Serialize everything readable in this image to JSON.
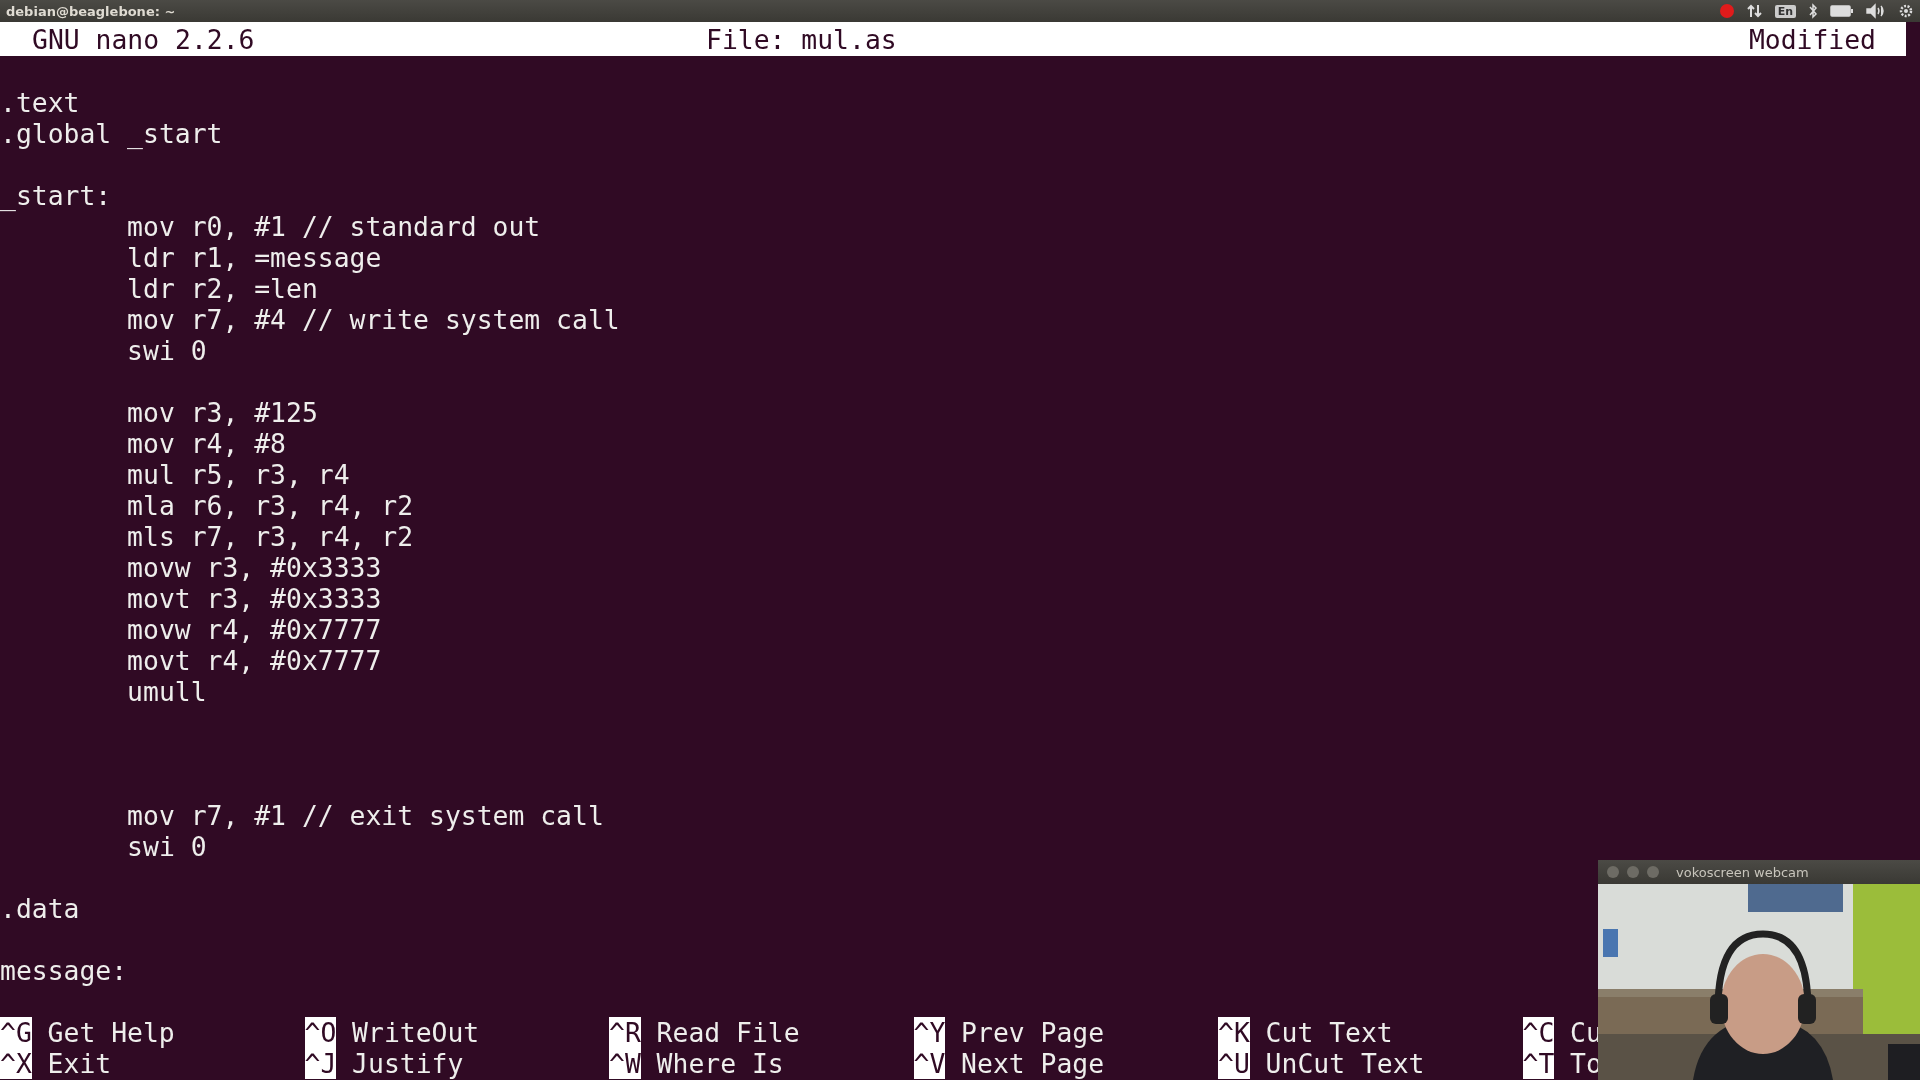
{
  "top_panel": {
    "title": "debian@beaglebone: ~",
    "keyboard_layout": "En"
  },
  "nano": {
    "header": {
      "version": "GNU nano 2.2.6",
      "file": "File: mul.as",
      "status": "Modified"
    },
    "lines": [
      {
        "kind": "blank"
      },
      {
        "kind": "code",
        "text": ".text"
      },
      {
        "kind": "code",
        "text": ".global _start"
      },
      {
        "kind": "blank"
      },
      {
        "kind": "code",
        "text": "_start:"
      },
      {
        "kind": "code",
        "text": "\tmov r0, #1 // standard out"
      },
      {
        "kind": "code",
        "text": "\tldr r1, =message"
      },
      {
        "kind": "code",
        "text": "\tldr r2, =len"
      },
      {
        "kind": "code",
        "text": "\tmov r7, #4 // write system call"
      },
      {
        "kind": "code",
        "text": "\tswi 0"
      },
      {
        "kind": "blank"
      },
      {
        "kind": "code",
        "text": "\tmov r3, #125"
      },
      {
        "kind": "code",
        "text": "\tmov r4, #8"
      },
      {
        "kind": "code",
        "text": "\tmul r5, r3, r4"
      },
      {
        "kind": "code",
        "text": "\tmla r6, r3, r4, r2"
      },
      {
        "kind": "code",
        "text": "\tmls r7, r3, r4, r2"
      },
      {
        "kind": "code",
        "text": "\tmovw r3, #0x3333"
      },
      {
        "kind": "code",
        "text": "\tmovt r3, #0x3333"
      },
      {
        "kind": "code",
        "text": "\tmovw r4, #0x7777"
      },
      {
        "kind": "code",
        "text": "\tmovt r4, #0x7777"
      },
      {
        "kind": "code",
        "text": "\tumull"
      },
      {
        "kind": "blank"
      },
      {
        "kind": "blank"
      },
      {
        "kind": "blank"
      },
      {
        "kind": "code",
        "text": "\tmov r7, #1 // exit system call"
      },
      {
        "kind": "code",
        "text": "\tswi 0"
      },
      {
        "kind": "blank"
      },
      {
        "kind": "code",
        "text": ".data"
      },
      {
        "kind": "blank"
      },
      {
        "kind": "code",
        "text": "message:"
      }
    ],
    "shortcuts": [
      {
        "top": {
          "key": "^G",
          "label": "Get Help"
        },
        "bottom": {
          "key": "^X",
          "label": "Exit"
        }
      },
      {
        "top": {
          "key": "^O",
          "label": "WriteOut"
        },
        "bottom": {
          "key": "^J",
          "label": "Justify"
        }
      },
      {
        "top": {
          "key": "^R",
          "label": "Read File"
        },
        "bottom": {
          "key": "^W",
          "label": "Where Is"
        }
      },
      {
        "top": {
          "key": "^Y",
          "label": "Prev Page"
        },
        "bottom": {
          "key": "^V",
          "label": "Next Page"
        }
      },
      {
        "top": {
          "key": "^K",
          "label": "Cut Text"
        },
        "bottom": {
          "key": "^U",
          "label": "UnCut Text"
        }
      },
      {
        "top": {
          "key": "^C",
          "label": "Cu"
        },
        "bottom": {
          "key": "^T",
          "label": "To"
        }
      }
    ]
  },
  "webcam": {
    "title": "vokoscreen webcam"
  }
}
